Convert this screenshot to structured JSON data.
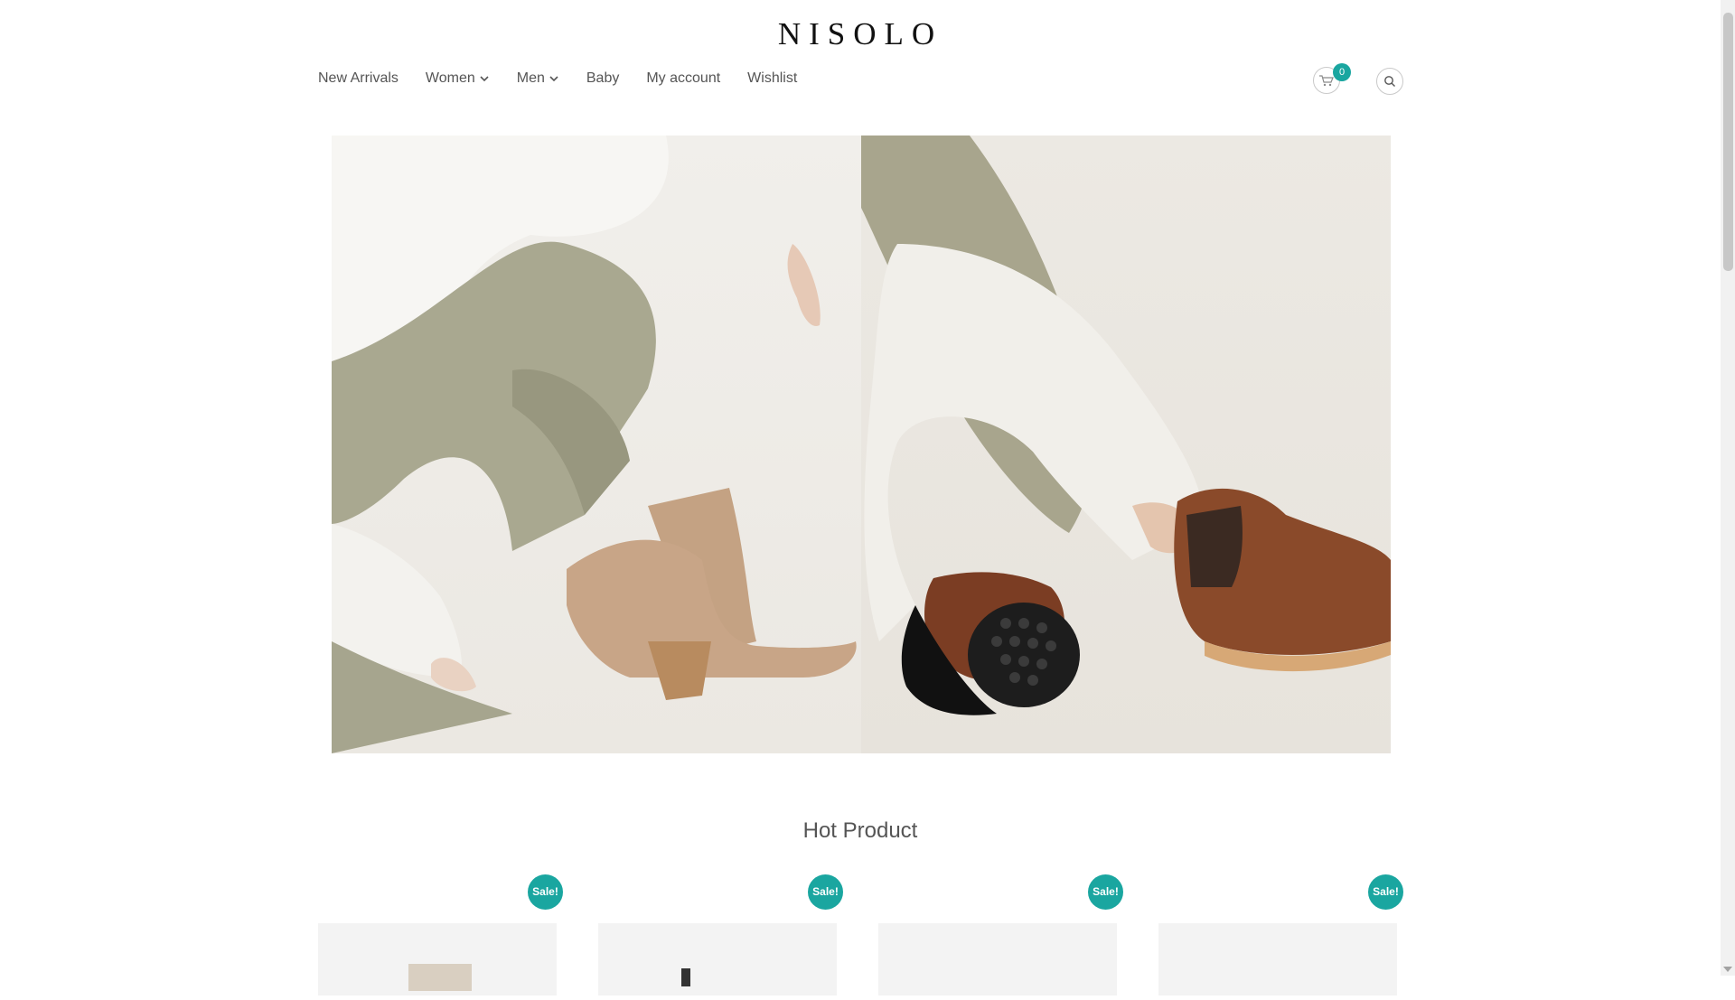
{
  "brand": {
    "logo": "NISOLO"
  },
  "nav": {
    "items": [
      {
        "label": "New Arrivals",
        "has_dropdown": false
      },
      {
        "label": "Women",
        "has_dropdown": true
      },
      {
        "label": "Men",
        "has_dropdown": true
      },
      {
        "label": "Baby",
        "has_dropdown": false
      },
      {
        "label": "My account",
        "has_dropdown": false
      },
      {
        "label": "Wishlist",
        "has_dropdown": false
      }
    ]
  },
  "header": {
    "cart_count": "0",
    "cart_icon": "cart-icon",
    "search_icon": "search-icon"
  },
  "colors": {
    "accent": "#1aa6a0",
    "text": "#555555",
    "logo": "#111111"
  },
  "sections": {
    "hot_product_title": "Hot Product"
  },
  "products": [
    {
      "badge": "Sale!"
    },
    {
      "badge": "Sale!"
    },
    {
      "badge": "Sale!"
    },
    {
      "badge": "Sale!"
    }
  ]
}
